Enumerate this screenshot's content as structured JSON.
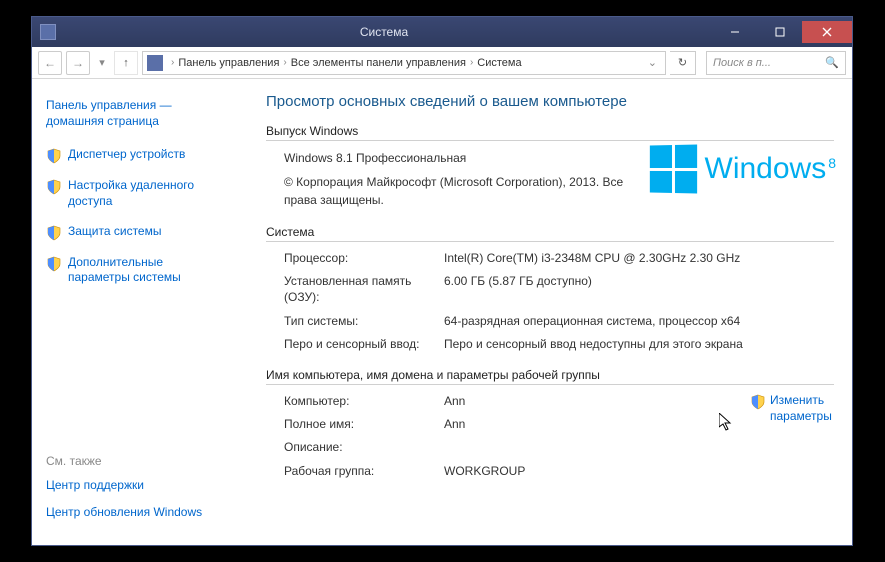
{
  "titlebar": {
    "title": "Система"
  },
  "breadcrumb": {
    "items": [
      "Панель управления",
      "Все элементы панели управления",
      "Система"
    ]
  },
  "search": {
    "placeholder": "Поиск в п..."
  },
  "sidebar": {
    "home": "Панель управления — домашняя страница",
    "links": [
      "Диспетчер устройств",
      "Настройка удаленного доступа",
      "Защита системы",
      "Дополнительные параметры системы"
    ],
    "see_also_label": "См. также",
    "see_also": [
      "Центр поддержки",
      "Центр обновления Windows"
    ]
  },
  "main": {
    "page_title": "Просмотр основных сведений о вашем компьютере",
    "edition_header": "Выпуск Windows",
    "edition_name": "Windows 8.1 Профессиональная",
    "copyright": "© Корпорация Майкрософт (Microsoft Corporation), 2013. Все права защищены.",
    "logo_text": "Windows",
    "logo_sup": "8",
    "system_header": "Система",
    "system_rows": [
      {
        "label": "Процессор:",
        "value": "Intel(R) Core(TM) i3-2348M CPU @ 2.30GHz   2.30 GHz"
      },
      {
        "label": "Установленная память (ОЗУ):",
        "value": "6.00 ГБ (5.87 ГБ доступно)"
      },
      {
        "label": "Тип системы:",
        "value": "64-разрядная операционная система, процессор x64"
      },
      {
        "label": "Перо и сенсорный ввод:",
        "value": "Перо и сенсорный ввод недоступны для этого экрана"
      }
    ],
    "name_header": "Имя компьютера, имя домена и параметры рабочей группы",
    "name_rows": [
      {
        "label": "Компьютер:",
        "value": "Ann"
      },
      {
        "label": "Полное имя:",
        "value": "Ann"
      },
      {
        "label": "Описание:",
        "value": ""
      },
      {
        "label": "Рабочая группа:",
        "value": "WORKGROUP"
      }
    ],
    "change_label": "Изменить параметры"
  }
}
